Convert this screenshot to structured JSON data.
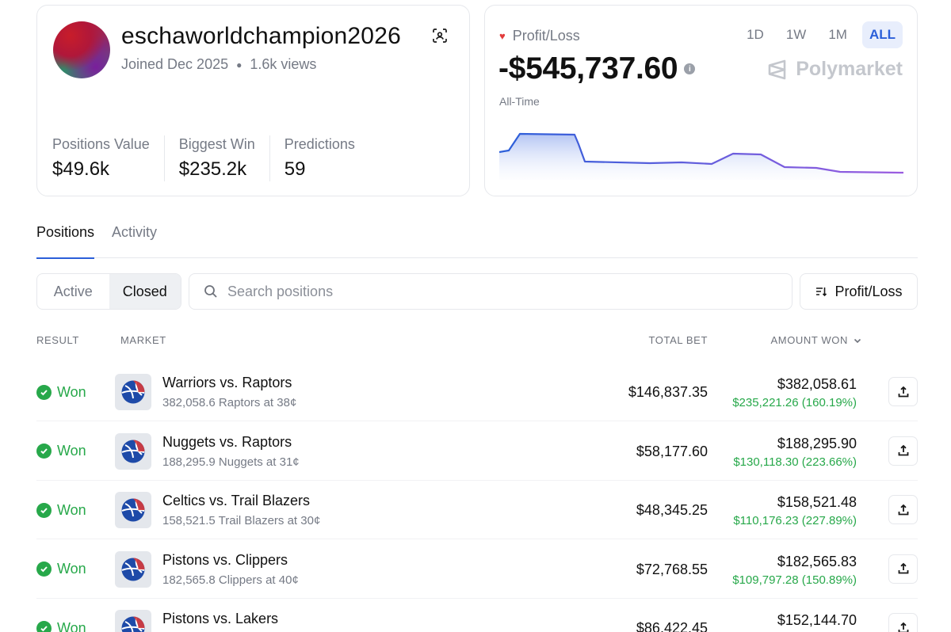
{
  "profile": {
    "username": "eschaworldchampion2026",
    "joined": "Joined Dec 2025",
    "views": "1.6k views",
    "stats": [
      {
        "label": "Positions Value",
        "value": "$49.6k"
      },
      {
        "label": "Biggest Win",
        "value": "$235.2k"
      },
      {
        "label": "Predictions",
        "value": "59"
      }
    ]
  },
  "pnl": {
    "label": "Profit/Loss",
    "value": "-$545,737.60",
    "period": "All-Time",
    "ranges": [
      "1D",
      "1W",
      "1M",
      "ALL"
    ],
    "active_range": "ALL",
    "brand": "Polymarket",
    "accent": "#2b5fd9"
  },
  "tabs": {
    "positions": "Positions",
    "activity": "Activity"
  },
  "filters": {
    "active": "Active",
    "closed": "Closed",
    "search_placeholder": "Search positions",
    "sort_label": "Profit/Loss"
  },
  "table": {
    "headers": {
      "result": "RESULT",
      "market": "MARKET",
      "total_bet": "TOTAL BET",
      "amount_won": "AMOUNT WON"
    },
    "rows": [
      {
        "result": "Won",
        "title": "Warriors vs. Raptors",
        "subtitle": "382,058.6 Raptors at 38¢",
        "total_bet": "$146,837.35",
        "amount_won": "$382,058.61",
        "gain": "$235,221.26 (160.19%)"
      },
      {
        "result": "Won",
        "title": "Nuggets vs. Raptors",
        "subtitle": "188,295.9 Nuggets at 31¢",
        "total_bet": "$58,177.60",
        "amount_won": "$188,295.90",
        "gain": "$130,118.30 (223.66%)"
      },
      {
        "result": "Won",
        "title": "Celtics vs. Trail Blazers",
        "subtitle": "158,521.5 Trail Blazers at 30¢",
        "total_bet": "$48,345.25",
        "amount_won": "$158,521.48",
        "gain": "$110,176.23 (227.89%)"
      },
      {
        "result": "Won",
        "title": "Pistons vs. Clippers",
        "subtitle": "182,565.8 Clippers at 40¢",
        "total_bet": "$72,768.55",
        "amount_won": "$182,565.83",
        "gain": "$109,797.28 (150.89%)"
      },
      {
        "result": "Won",
        "title": "Pistons vs. Lakers",
        "subtitle": "",
        "total_bet": "$86,422.45",
        "amount_won": "$152,144.70",
        "gain": ""
      }
    ]
  },
  "colors": {
    "won_green": "#27a84a",
    "loss_red": "#e23b3b",
    "chart_line_start": "#2b5fd9",
    "chart_line_end": "#9b5ce0"
  }
}
